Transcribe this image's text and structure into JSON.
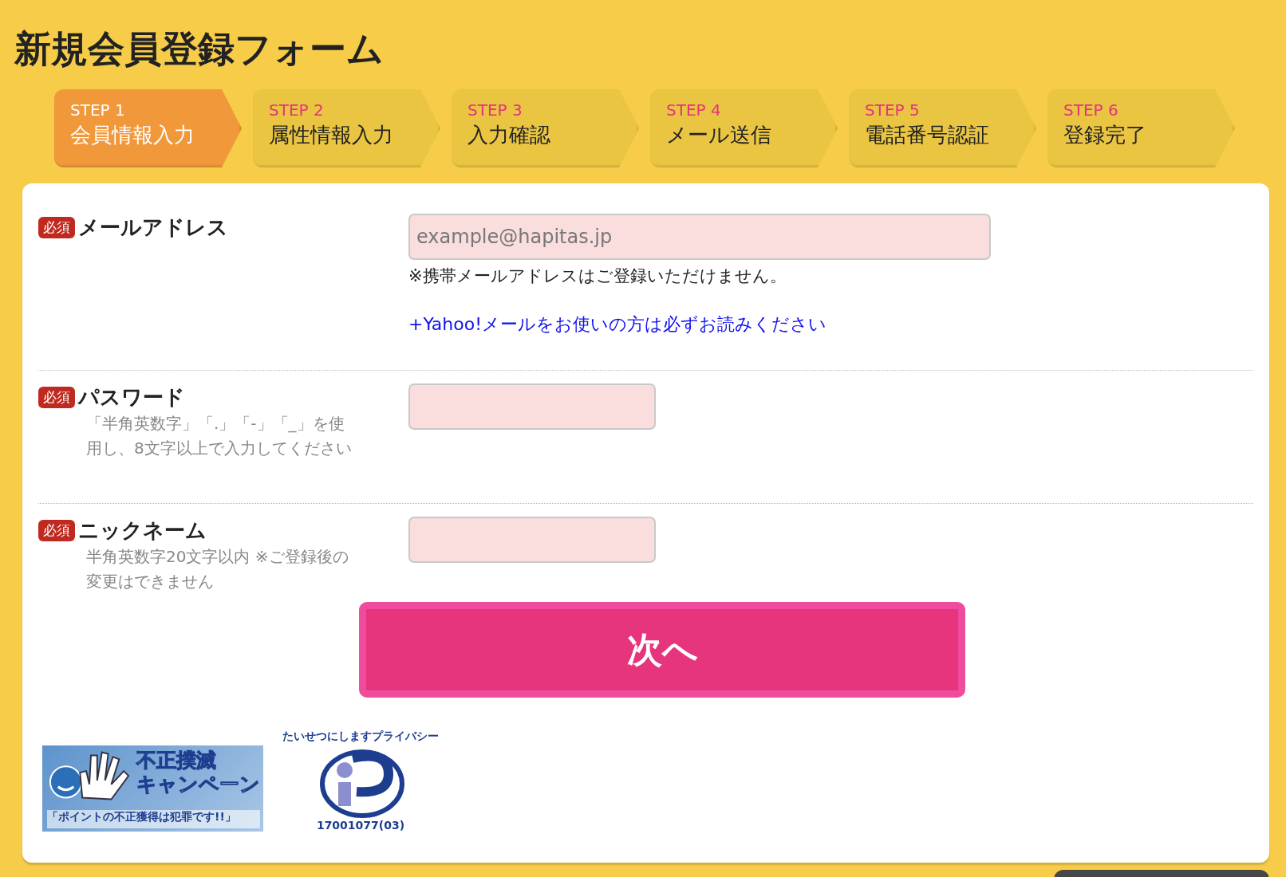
{
  "title": "新規会員登録フォーム",
  "steps": [
    {
      "label": "STEP 1",
      "name": "会員情報入力",
      "selected": true
    },
    {
      "label": "STEP 2",
      "name": "属性情報入力",
      "selected": false
    },
    {
      "label": "STEP 3",
      "name": "入力確認",
      "selected": false
    },
    {
      "label": "STEP 4",
      "name": "メール送信",
      "selected": false
    },
    {
      "label": "STEP 5",
      "name": "電話番号認証",
      "selected": false
    },
    {
      "label": "STEP 6",
      "name": "登録完了",
      "selected": false
    }
  ],
  "fields": [
    {
      "kind": "email",
      "badge": "必須",
      "label": "メールアドレス",
      "placeholder": "example@hapitas.jp",
      "note": "※携帯メールアドレスはご登録いただけません。",
      "link": "+Yahoo!メールをお使いの方は必ずお読みください"
    },
    {
      "kind": "password",
      "badge": "必須",
      "label": "パスワード",
      "hint": "「半角英数字」「.」「-」「_」を使用し、8文字以上で入力してください"
    },
    {
      "kind": "text",
      "badge": "必須",
      "label": "ニックネーム",
      "hint": "半角英数字20文字以内 ※ご登録後の変更はできません"
    }
  ],
  "submit": "次へ",
  "campaign_banner": {
    "title_1": "不正撲滅",
    "title_2": "キャンペーン",
    "caption": "「ポイントの不正獲得は犯罪です!!」"
  },
  "privacy_mark": {
    "arc_text": "たいせつにしますプライバシー",
    "number": "17001077(03)"
  }
}
